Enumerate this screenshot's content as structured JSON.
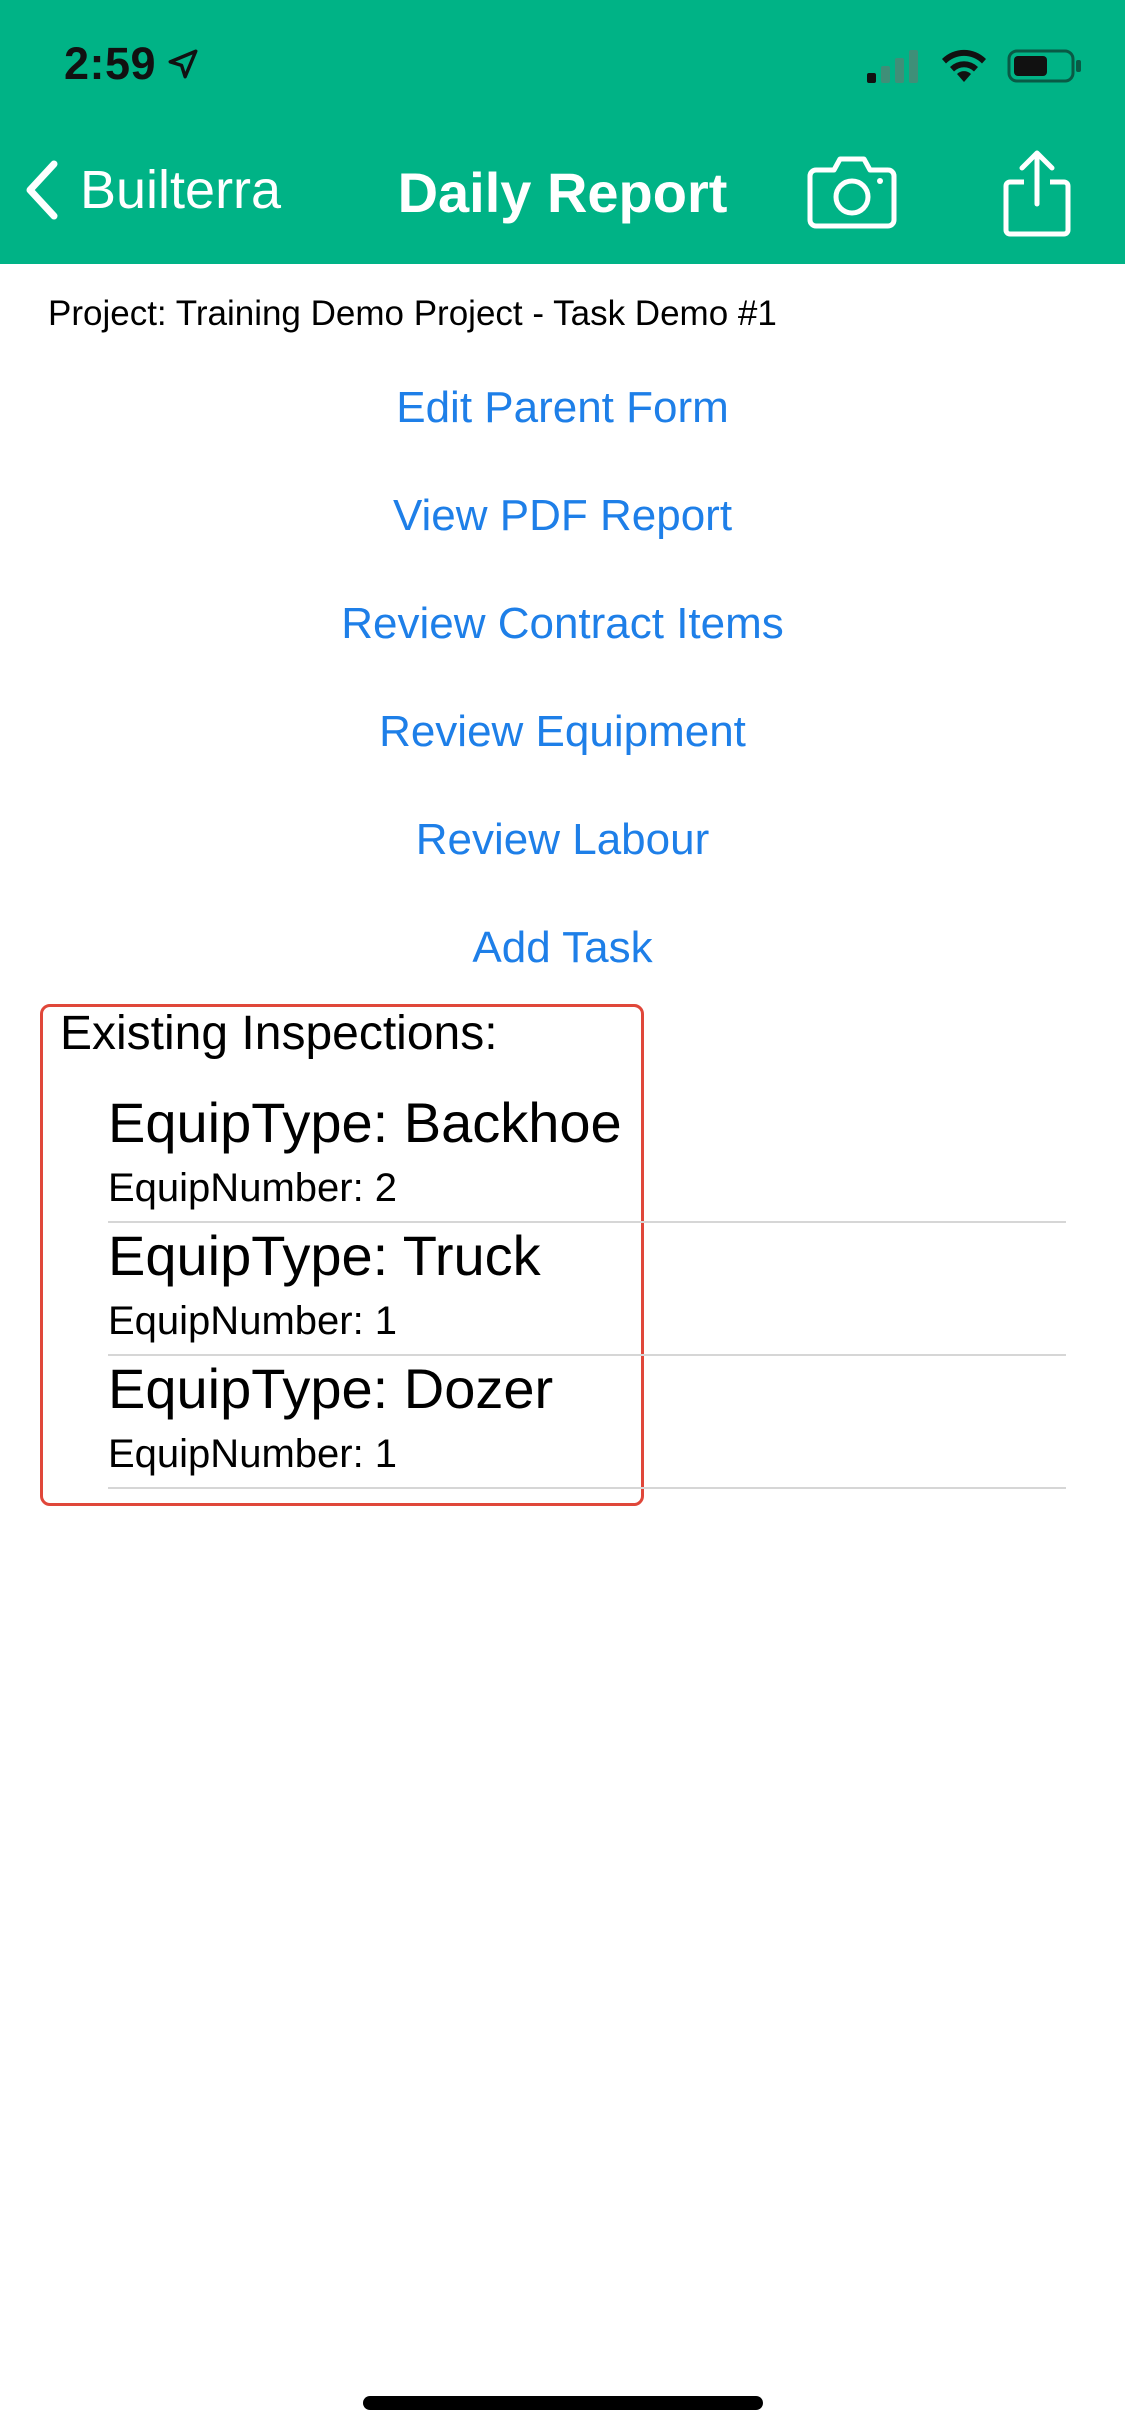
{
  "status_bar": {
    "time": "2:59",
    "icons": [
      "location-arrow-icon",
      "cellular-signal-icon",
      "wifi-icon",
      "battery-icon"
    ]
  },
  "nav": {
    "back_label": "Builterra",
    "title": "Daily Report",
    "icons": [
      "chevron-left-icon",
      "camera-icon",
      "share-icon"
    ]
  },
  "project": {
    "line": "Project: Training Demo Project - Task Demo #1"
  },
  "actions": [
    {
      "label": "Edit Parent Form"
    },
    {
      "label": "View PDF Report"
    },
    {
      "label": "Review Contract Items"
    },
    {
      "label": "Review Equipment"
    },
    {
      "label": "Review Labour"
    },
    {
      "label": "Add Task"
    }
  ],
  "inspections": {
    "heading": "Existing Inspections:",
    "items": [
      {
        "type": "EquipType: Backhoe",
        "number": "EquipNumber: 2"
      },
      {
        "type": "EquipType: Truck",
        "number": "EquipNumber: 1"
      },
      {
        "type": "EquipType: Dozer",
        "number": "EquipNumber: 1"
      }
    ]
  },
  "colors": {
    "header_green": "#00B386",
    "link_blue": "#1E7FE8",
    "highlight_red": "#E0473A"
  }
}
